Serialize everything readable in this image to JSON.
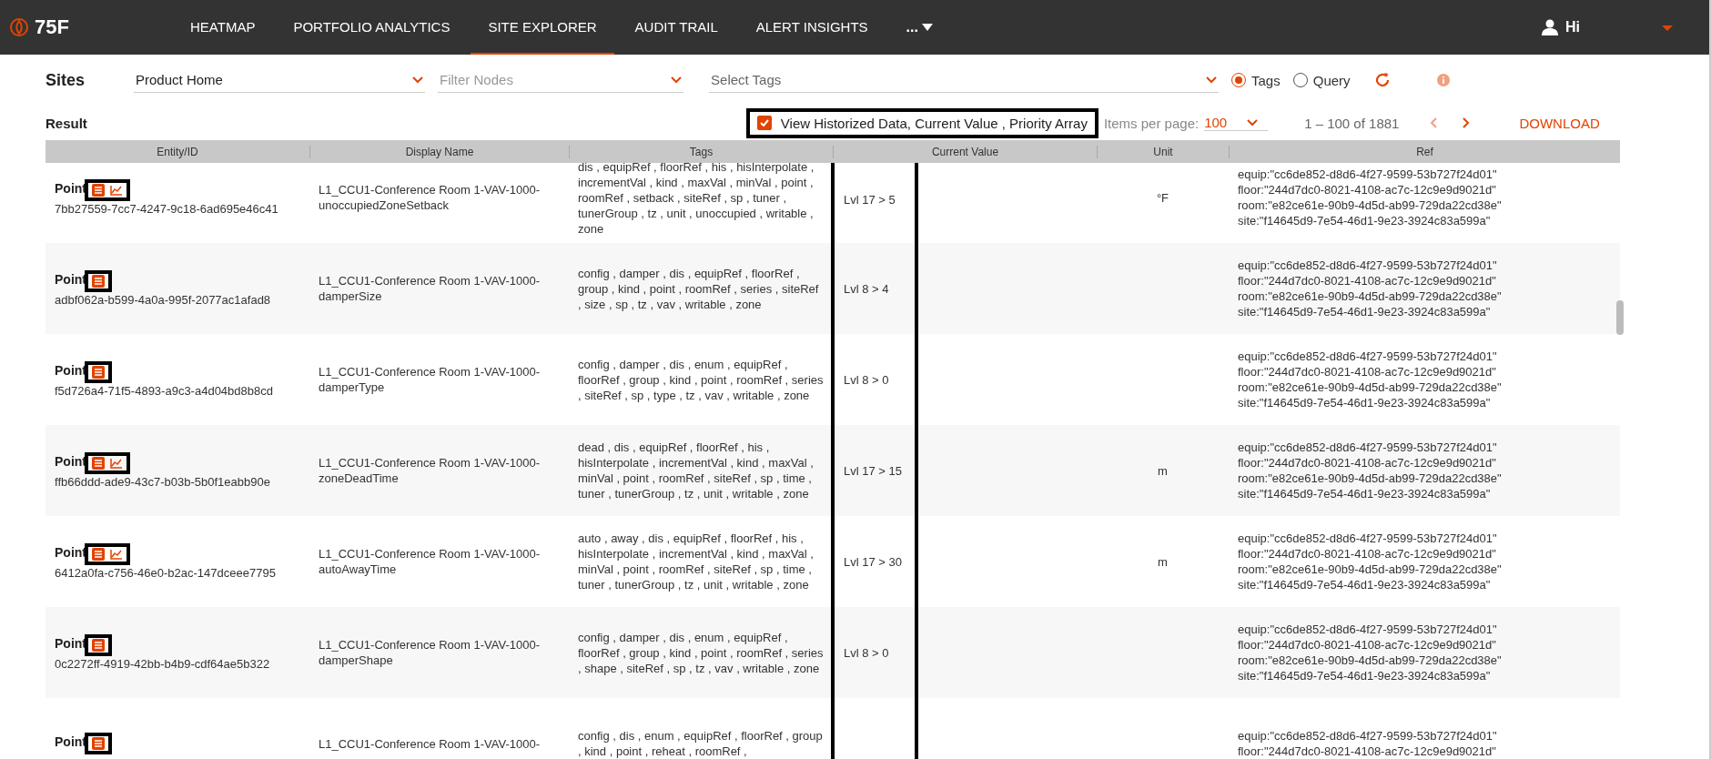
{
  "nav": {
    "logo": "75F",
    "items": [
      {
        "label": "HEATMAP",
        "selected": false
      },
      {
        "label": "PORTFOLIO ANALYTICS",
        "selected": false
      },
      {
        "label": "SITE EXPLORER",
        "selected": true
      },
      {
        "label": "AUDIT TRAIL",
        "selected": false
      },
      {
        "label": "ALERT INSIGHTS",
        "selected": false
      }
    ],
    "more": "...",
    "user": "Hi"
  },
  "filters": {
    "title": "Sites",
    "site": "Product Home",
    "nodes_placeholder": "Filter Nodes",
    "tags_placeholder": "Select Tags",
    "modes": [
      {
        "label": "Tags",
        "selected": true
      },
      {
        "label": "Query",
        "selected": false
      }
    ]
  },
  "result": {
    "title": "Result",
    "historized": {
      "label": "View Historized Data, Current Value , Priority Array",
      "checked": true
    },
    "per_page_label": "Items per page:",
    "per_page": "100",
    "range": "1 – 100 of 1881",
    "download": "DOWNLOAD"
  },
  "table": {
    "columns": [
      "Entity/ID",
      "Display Name",
      "Tags",
      "Current Value",
      "Unit",
      "Ref"
    ],
    "rows": [
      {
        "type": "Point",
        "id": "7bb27559-7cc7-4247-9c18-6ad695e46c41",
        "chart": true,
        "display": "L1_CCU1-Conference Room 1-VAV-1000-unoccupiedZoneSetback",
        "tags": "dis , equipRef , floorRef , his , hisInterpolate , incrementVal , kind , maxVal , minVal , point , roomRef , setback , siteRef , sp , tuner , tunerGroup , tz , unit , unoccupied , writable , zone",
        "value": "Lvl 17 > 5",
        "unit": "°F",
        "ref": [
          "equip:\"cc6de852-d8d6-4f27-9599-53b727f24d01\"",
          "floor:\"244d7dc0-8021-4108-ac7c-12c9e9d9021d\"",
          "room:\"e82ce61e-90b9-4d5d-ab99-729da22cd38e\"",
          "site:\"f14645d9-7e54-46d1-9e23-3924c83a599a\""
        ]
      },
      {
        "type": "Point",
        "id": "adbf062a-b599-4a0a-995f-2077ac1afad8",
        "chart": false,
        "display": "L1_CCU1-Conference Room 1-VAV-1000-damperSize",
        "tags": "config , damper , dis , equipRef , floorRef , group , kind , point , roomRef , series , siteRef , size , sp , tz , vav , writable , zone",
        "value": "Lvl 8 > 4",
        "unit": "",
        "ref": [
          "equip:\"cc6de852-d8d6-4f27-9599-53b727f24d01\"",
          "floor:\"244d7dc0-8021-4108-ac7c-12c9e9d9021d\"",
          "room:\"e82ce61e-90b9-4d5d-ab99-729da22cd38e\"",
          "site:\"f14645d9-7e54-46d1-9e23-3924c83a599a\""
        ]
      },
      {
        "type": "Point",
        "id": "f5d726a4-71f5-4893-a9c3-a4d04bd8b8cd",
        "chart": false,
        "display": "L1_CCU1-Conference Room 1-VAV-1000-damperType",
        "tags": "config , damper , dis , enum , equipRef , floorRef , group , kind , point , roomRef , series , siteRef , sp , type , tz , vav , writable , zone",
        "value": "Lvl 8 > 0",
        "unit": "",
        "ref": [
          "equip:\"cc6de852-d8d6-4f27-9599-53b727f24d01\"",
          "floor:\"244d7dc0-8021-4108-ac7c-12c9e9d9021d\"",
          "room:\"e82ce61e-90b9-4d5d-ab99-729da22cd38e\"",
          "site:\"f14645d9-7e54-46d1-9e23-3924c83a599a\""
        ]
      },
      {
        "type": "Point",
        "id": "ffb66ddd-ade9-43c7-b03b-5b0f1eabb90e",
        "chart": true,
        "display": "L1_CCU1-Conference Room 1-VAV-1000-zoneDeadTime",
        "tags": "dead , dis , equipRef , floorRef , his , hisInterpolate , incrementVal , kind , maxVal , minVal , point , roomRef , siteRef , sp , time , tuner , tunerGroup , tz , unit , writable , zone",
        "value": "Lvl 17 > 15",
        "unit": "m",
        "ref": [
          "equip:\"cc6de852-d8d6-4f27-9599-53b727f24d01\"",
          "floor:\"244d7dc0-8021-4108-ac7c-12c9e9d9021d\"",
          "room:\"e82ce61e-90b9-4d5d-ab99-729da22cd38e\"",
          "site:\"f14645d9-7e54-46d1-9e23-3924c83a599a\""
        ]
      },
      {
        "type": "Point",
        "id": "6412a0fa-c756-46e0-b2ac-147dceee7795",
        "chart": true,
        "display": "L1_CCU1-Conference Room 1-VAV-1000-autoAwayTime",
        "tags": "auto , away , dis , equipRef , floorRef , his , hisInterpolate , incrementVal , kind , maxVal , minVal , point , roomRef , siteRef , sp , time , tuner , tunerGroup , tz , unit , writable , zone",
        "value": "Lvl 17 > 30",
        "unit": "m",
        "ref": [
          "equip:\"cc6de852-d8d6-4f27-9599-53b727f24d01\"",
          "floor:\"244d7dc0-8021-4108-ac7c-12c9e9d9021d\"",
          "room:\"e82ce61e-90b9-4d5d-ab99-729da22cd38e\"",
          "site:\"f14645d9-7e54-46d1-9e23-3924c83a599a\""
        ]
      },
      {
        "type": "Point",
        "id": "0c2272ff-4919-42bb-b4b9-cdf64ae5b322",
        "chart": false,
        "display": "L1_CCU1-Conference Room 1-VAV-1000-damperShape",
        "tags": "config , damper , dis , enum , equipRef , floorRef , group , kind , point , roomRef , series , shape , siteRef , sp , tz , vav , writable , zone",
        "value": "Lvl 8 > 0",
        "unit": "",
        "ref": [
          "equip:\"cc6de852-d8d6-4f27-9599-53b727f24d01\"",
          "floor:\"244d7dc0-8021-4108-ac7c-12c9e9d9021d\"",
          "room:\"e82ce61e-90b9-4d5d-ab99-729da22cd38e\"",
          "site:\"f14645d9-7e54-46d1-9e23-3924c83a599a\""
        ]
      },
      {
        "type": "Point",
        "id": "",
        "chart": false,
        "display": "L1_CCU1-Conference Room 1-VAV-1000-",
        "tags": "config , dis , enum , equipRef , floorRef , group , kind , point , reheat , roomRef ,",
        "value": "",
        "unit": "",
        "ref": [
          "equip:\"cc6de852-d8d6-4f27-9599-53b727f24d01\"",
          "floor:\"244d7dc0-8021-4108-ac7c-12c9e9d9021d\""
        ]
      }
    ]
  }
}
